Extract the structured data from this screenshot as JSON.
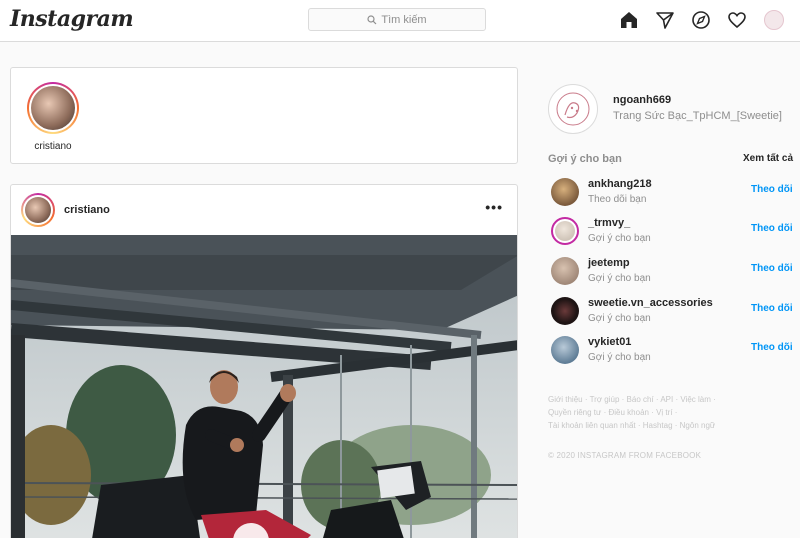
{
  "header": {
    "logo": "Instagram",
    "search_placeholder": "Tìm kiếm",
    "icons": [
      "home-icon",
      "direct-icon",
      "explore-icon",
      "activity-icon",
      "profile-avatar"
    ]
  },
  "stories": [
    {
      "username": "cristiano"
    }
  ],
  "post": {
    "username": "cristiano",
    "more_label": "•••"
  },
  "profile": {
    "username": "ngoanh669",
    "full_name": "Trang Sức Bạc_TpHCM_[Sweetie]"
  },
  "suggestions": {
    "title": "Gợi ý cho bạn",
    "see_all": "Xem tất cả",
    "items": [
      {
        "username": "ankhang218",
        "subtitle": "Theo dõi bạn",
        "action": "Theo dõi",
        "avatar_color": "#7b5a3c"
      },
      {
        "username": "_trmvy_",
        "subtitle": "Gợi ý cho bạn",
        "action": "Theo dõi",
        "avatar_color": "#cfc4b8"
      },
      {
        "username": "jeetemp",
        "subtitle": "Gợi ý cho bạn",
        "action": "Theo dõi",
        "avatar_color": "#a08878"
      },
      {
        "username": "sweetie.vn_accessories",
        "subtitle": "Gợi ý cho bạn",
        "action": "Theo dõi",
        "avatar_color": "#1e1414"
      },
      {
        "username": "vykiet01",
        "subtitle": "Gợi ý cho bạn",
        "action": "Theo dõi",
        "avatar_color": "#5f7d96"
      }
    ]
  },
  "footer": {
    "links": [
      "Giới thiệu",
      "Trợ giúp",
      "Báo chí",
      "API",
      "Việc làm",
      "Quyền riêng tư",
      "Điều khoản",
      "Vị trí",
      "Tài khoản liên quan nhất",
      "Hashtag",
      "Ngôn ngữ"
    ],
    "copyright": "© 2020 INSTAGRAM FROM FACEBOOK"
  },
  "colors": {
    "link_blue": "#0095f6",
    "border": "#dbdbdb",
    "muted": "#8e8e8e"
  }
}
